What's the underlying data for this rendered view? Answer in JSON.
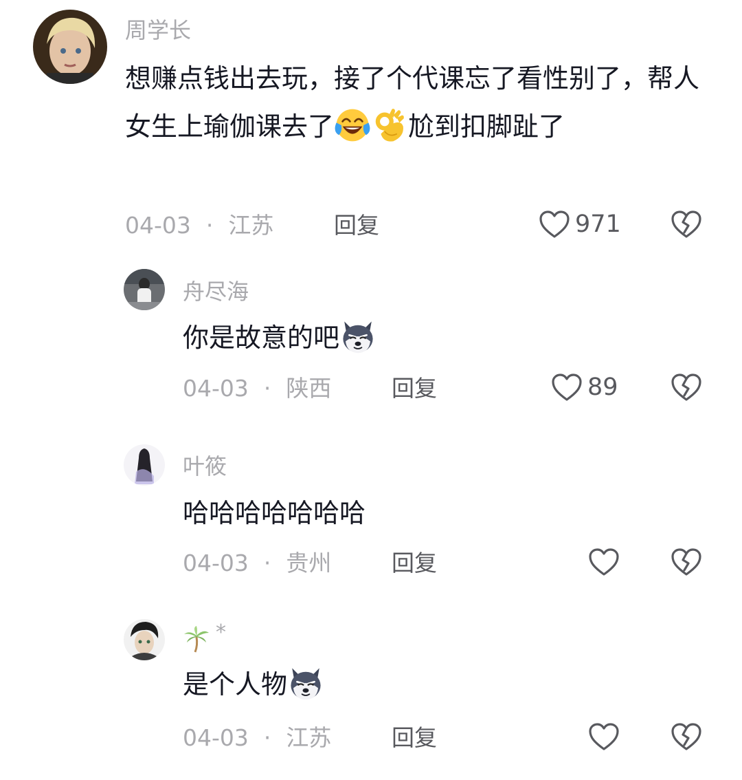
{
  "comments": [
    {
      "name": "周学长",
      "text_a": "想赚点钱出去玩，接了个代课忘了看性别了，帮人女生上瑜伽课去了",
      "text_b": "尬到扣脚趾了",
      "date": "04-03",
      "location": "江苏",
      "reply": "回复",
      "likes": "971",
      "emojis": [
        "laughing-crying-emoji",
        "ok-hand-emoji"
      ]
    },
    {
      "name": "舟尽海",
      "text": "你是故意的吧",
      "date": "04-03",
      "location": "陕西",
      "reply": "回复",
      "likes": "89",
      "emojis": [
        "husky-dog-emoji"
      ]
    },
    {
      "name": "叶筱",
      "text": "哈哈哈哈哈哈哈",
      "date": "04-03",
      "location": "贵州",
      "reply": "回复",
      "likes": ""
    },
    {
      "name": "🌴*",
      "text": "是个人物",
      "date": "04-03",
      "location": "江苏",
      "reply": "回复",
      "likes": "",
      "emojis": [
        "husky-dog-emoji"
      ]
    }
  ],
  "separator": "·",
  "icons": {
    "like": "heart-outline-icon",
    "dislike": "broken-heart-icon"
  },
  "colors": {
    "meta": "#a9a9ad",
    "text": "#161823",
    "action": "#58595e"
  }
}
